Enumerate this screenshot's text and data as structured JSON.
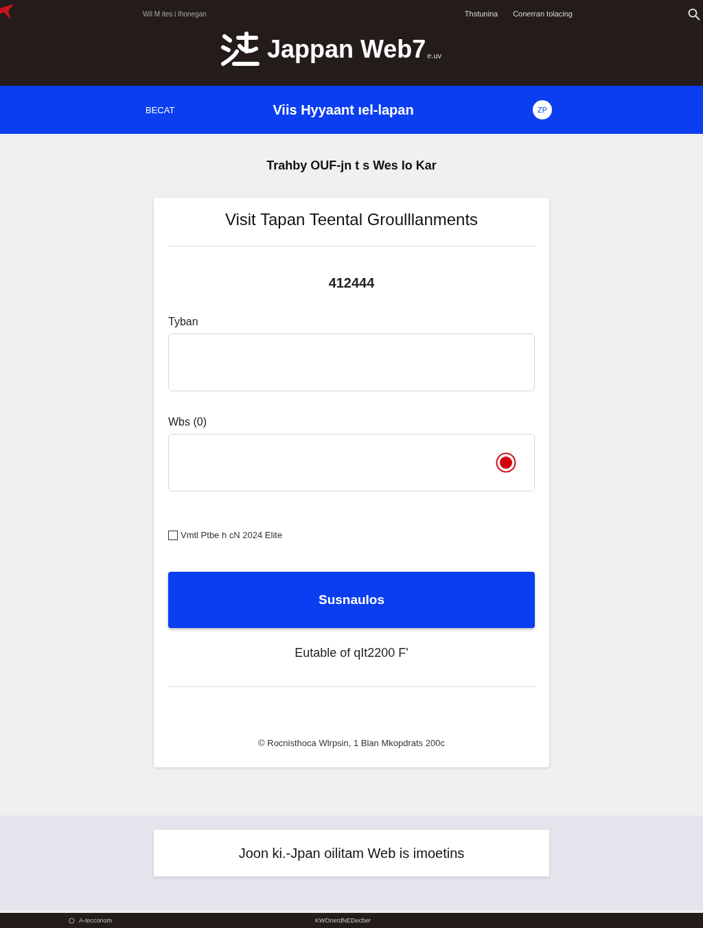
{
  "top_bar": {
    "tagline": "Wil M ites i Ihonegan",
    "links": [
      "Thstunina",
      "Conerran tolacing"
    ]
  },
  "logo": {
    "title": "Jappan Web7",
    "suffix": "e.uv"
  },
  "blue_bar": {
    "left": "BECAT",
    "title": "Viis Hyyaant ıel-lapan",
    "badge": "ZP"
  },
  "subheading": "Trahby OUF-jn t s Wes lo Kar",
  "card": {
    "title": "Visit Tapan Teental Groulllanments",
    "code": "412444",
    "fields": [
      {
        "label": "Tyban",
        "radio": false
      },
      {
        "label": "Wbs (0)",
        "radio": true
      }
    ],
    "checkbox": {
      "label": "Vmtl Ptbe h cN 2024 Elite",
      "checked": false
    },
    "button": "Susnaulos",
    "note": "Eutable of qIt2200 F'",
    "footer": "© Rocnisthoca Wlrpsin, 1 Blan Mkopdrats 200c"
  },
  "banner": "Joon ki.-Jpan oilitam Web is imoetins",
  "bottom_bar": {
    "left": "A-tecconom",
    "center": "KWOnerdNEDecber"
  }
}
